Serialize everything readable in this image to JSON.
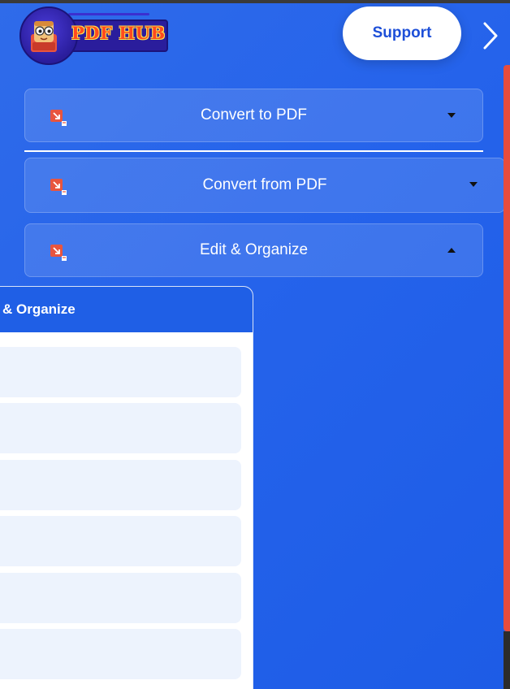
{
  "header": {
    "logo_text": "PDF HUB",
    "support_label": "Support"
  },
  "menu": {
    "items": [
      {
        "label": "Convert to PDF",
        "state": "collapsed"
      },
      {
        "label": "Convert from PDF",
        "state": "collapsed"
      },
      {
        "label": "Edit & Organize",
        "state": "expanded"
      }
    ]
  },
  "dropdown": {
    "title": "& Organize",
    "rows": [
      "",
      "",
      "",
      "",
      "",
      ""
    ]
  },
  "colors": {
    "panel_blue": "#2563eb",
    "icon_red": "#e8553f",
    "support_text": "#1d4fd8"
  },
  "icons": [
    "chevron-right-icon",
    "convert-arrow-icon",
    "caret-down-icon",
    "caret-up-icon"
  ]
}
